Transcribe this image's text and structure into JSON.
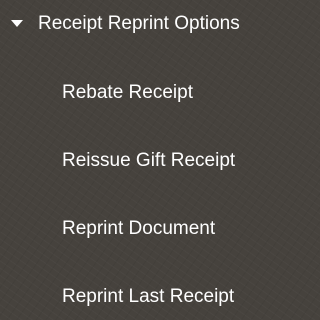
{
  "menu": {
    "group": {
      "label": "Receipt Reprint Options",
      "expanded_icon": "caret-down-icon"
    },
    "items": [
      {
        "label": "Rebate Receipt"
      },
      {
        "label": "Reissue Gift Receipt"
      },
      {
        "label": "Reprint Document"
      },
      {
        "label": "Reprint Last Receipt"
      }
    ]
  },
  "colors": {
    "background": "#46423d",
    "text": "#ffffff"
  }
}
